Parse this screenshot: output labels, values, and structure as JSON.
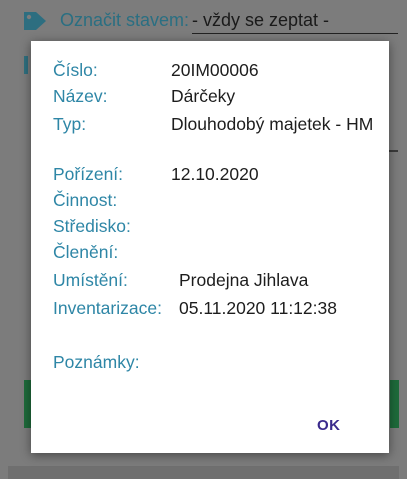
{
  "background": {
    "mark_label": "Označit stavem:",
    "mark_value": "- vždy se zeptat -",
    "icons": {
      "tag": "tag-icon"
    }
  },
  "dialog": {
    "fields": [
      {
        "label": "Číslo:",
        "value": "20IM00006"
      },
      {
        "label": "Název:",
        "value": "Dárčeky"
      },
      {
        "label": "Typ:",
        "value": "Dlouhodobý majetek - HM"
      },
      {
        "label": "Pořízení:",
        "value": "12.10.2020"
      },
      {
        "label": "Činnost:",
        "value": ""
      },
      {
        "label": "Středisko:",
        "value": ""
      },
      {
        "label": "Členění:",
        "value": ""
      },
      {
        "label": "Umístění:",
        "value": "Prodejna Jihlava"
      },
      {
        "label": "Inventarizace:",
        "value": "05.11.2020 11:12:38"
      }
    ],
    "notes_label": "Poznámky:",
    "ok_label": "OK"
  },
  "colors": {
    "label": "#2e86a6",
    "value": "#1d1d1d",
    "ok": "#3a2a8c",
    "overlay": "#7c7c7c"
  }
}
